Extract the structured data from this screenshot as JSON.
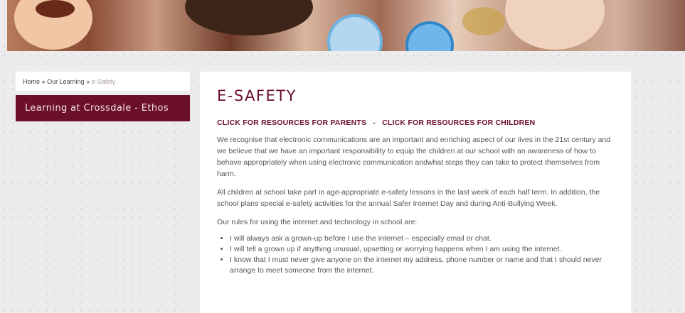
{
  "breadcrumb": {
    "home": "Home",
    "separator1": "»",
    "section": "Our Learning",
    "separator2": "»",
    "current": "e-Safety"
  },
  "sidebar": {
    "active_item": "Learning at Crossdale - Ethos"
  },
  "main": {
    "title": "E-SAFETY",
    "links": {
      "parents": "CLICK FOR RESOURCES FOR PARENTS",
      "separator": "-",
      "children": "CLICK FOR RESOURCES FOR CHILDREN"
    },
    "paragraphs": [
      "We recognise that electronic communications are an important and enriching aspect of our lives in the 21st century and we believe that we have an important responsibility to equip the children at our school with an awareness of how to behave appropriately when using electronic communication andwhat steps they can take to protect themselves from harm.",
      "All children at school take part in age-appropriate e-safety lessons in the last week of each half term. In addition, the school plans special e-safety activities for the annual Safer Internet Day and during Anti-Bullying Week.",
      "Our rules for using the internet and technology in school are:"
    ],
    "rules": [
      "I will always ask a grown-up before I use the internet – especially email or chat.",
      "I will tell a grown up if anything unusual, upsetting or worrying happens when I am using the internet.",
      "I know that I must never give anyone on the internet my address, phone number or name and that I should never arrange to meet someone from the internet."
    ]
  },
  "colors": {
    "brand": "#6b0f2a",
    "background": "#ececec"
  }
}
